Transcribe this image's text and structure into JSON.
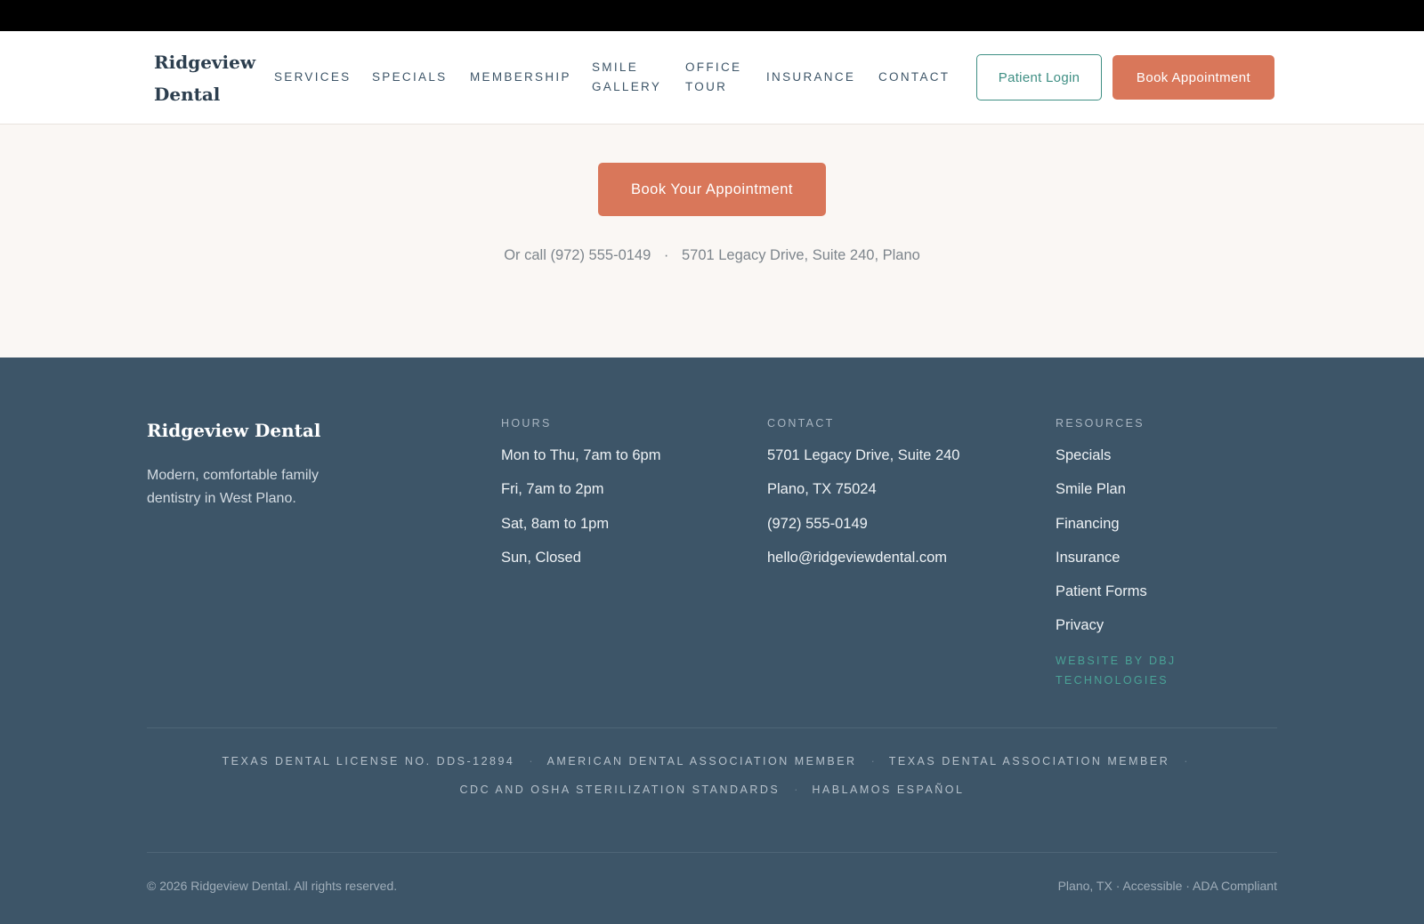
{
  "header": {
    "logo": "Ridgeview Dental",
    "nav": [
      {
        "label": "SERVICES"
      },
      {
        "label": "SPECIALS"
      },
      {
        "label": "MEMBERSHIP"
      },
      {
        "label": "SMILE GALLERY"
      },
      {
        "label": "OFFICE TOUR"
      },
      {
        "label": "INSURANCE"
      },
      {
        "label": "CONTACT"
      }
    ],
    "login_label": "Patient Login",
    "book_label": "Book Appointment"
  },
  "cta": {
    "button_label": "Book Your Appointment",
    "call_text": "Or call (972) 555-0149",
    "separator": "·",
    "address_text": "5701 Legacy Drive, Suite 240, Plano"
  },
  "footer": {
    "brand": "Ridgeview Dental",
    "tagline": "Modern, comfortable family dentistry in West Plano.",
    "hours": {
      "title": "HOURS",
      "items": [
        "Mon to Thu, 7am to 6pm",
        "Fri, 7am to 2pm",
        "Sat, 8am to 1pm",
        "Sun, Closed"
      ]
    },
    "contact": {
      "title": "CONTACT",
      "items": [
        "5701 Legacy Drive, Suite 240",
        "Plano, TX 75024",
        "(972) 555-0149",
        "hello@ridgeviewdental.com"
      ]
    },
    "resources": {
      "title": "RESOURCES",
      "items": [
        "Specials",
        "Smile Plan",
        "Financing",
        "Insurance",
        "Patient Forms",
        "Privacy"
      ],
      "credit": "WEBSITE BY DBJ TECHNOLOGIES"
    },
    "associations_row1": [
      "TEXAS DENTAL LICENSE NO. DDS-12894",
      "AMERICAN DENTAL ASSOCIATION MEMBER",
      "TEXAS DENTAL ASSOCIATION MEMBER"
    ],
    "associations_row2": [
      "CDC AND OSHA STERILIZATION STANDARDS",
      "HABLAMOS ESPAÑOL"
    ],
    "copyright": "© 2026 Ridgeview Dental. All rights reserved.",
    "bottom_right": "Plano, TX · Accessible · ADA Compliant"
  },
  "colors": {
    "accent": "#d9775a",
    "teal": "#3f8f84",
    "footer_bg": "#3d5568",
    "page_bg": "#faf7f4"
  }
}
